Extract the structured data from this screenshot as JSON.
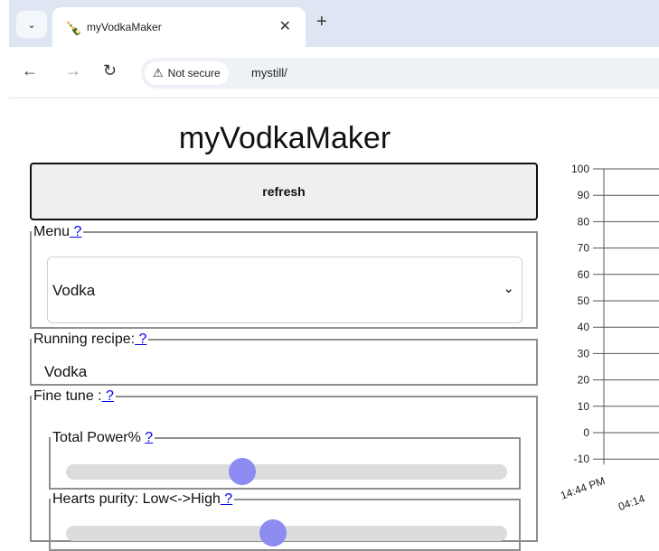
{
  "browser": {
    "tab_title": "myVodkaMaker",
    "tab_menu_icon": "chevron-down-icon",
    "favicon_icon": "bottle-icon",
    "close_icon": "close-icon",
    "new_tab_icon": "plus-icon",
    "security_label": "Not secure",
    "url": "mystill/"
  },
  "page": {
    "title": "myVodkaMaker",
    "refresh_label": "refresh"
  },
  "menu": {
    "legend": "Menu",
    "help": " ?",
    "selected": "Vodka"
  },
  "running": {
    "legend": "Running recipe:",
    "help": " ?",
    "value": "Vodka"
  },
  "finetune": {
    "legend": "Fine tune :",
    "help": " ?",
    "sliders": [
      {
        "legend": "Total Power% ",
        "help": " ?",
        "level": 0.4
      },
      {
        "legend": "Hearts purity: Low<->High",
        "help": " ?",
        "level": 0.47
      }
    ]
  },
  "chart_data": {
    "type": "line",
    "yticks": [
      "100",
      "90",
      "80",
      "70",
      "60",
      "50",
      "40",
      "30",
      "20",
      "10",
      "0",
      "-10"
    ],
    "ylim": [
      -10,
      100
    ],
    "xticks": [
      "14:44 PM",
      "04:14"
    ],
    "grid": true,
    "series": []
  }
}
